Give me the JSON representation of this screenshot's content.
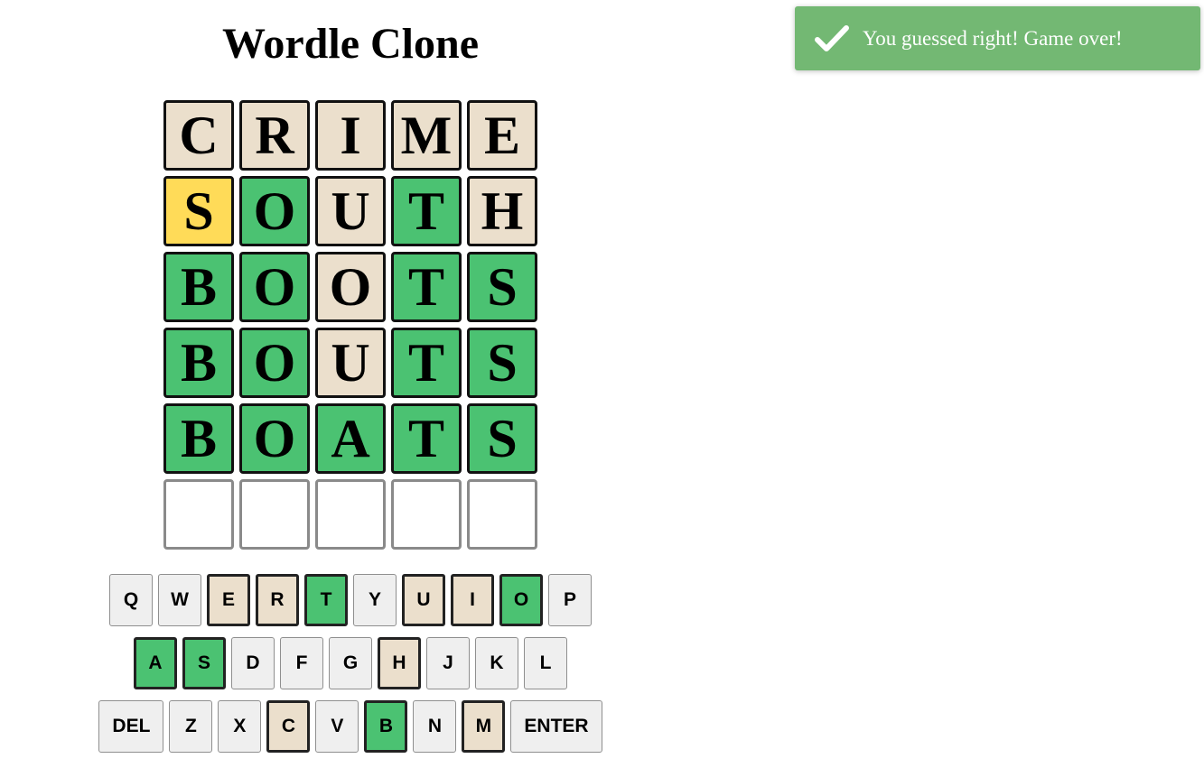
{
  "app": {
    "title": "Wordle Clone"
  },
  "colors": {
    "correct": "#4bc272",
    "present": "#ffdb58",
    "absent": "#ebdfcc",
    "empty": "#ffffff",
    "toast_bg": "#73b873"
  },
  "board": {
    "rows": [
      [
        {
          "letter": "C",
          "state": "absent"
        },
        {
          "letter": "R",
          "state": "absent"
        },
        {
          "letter": "I",
          "state": "absent"
        },
        {
          "letter": "M",
          "state": "absent"
        },
        {
          "letter": "E",
          "state": "absent"
        }
      ],
      [
        {
          "letter": "S",
          "state": "present"
        },
        {
          "letter": "O",
          "state": "correct"
        },
        {
          "letter": "U",
          "state": "absent"
        },
        {
          "letter": "T",
          "state": "correct"
        },
        {
          "letter": "H",
          "state": "absent"
        }
      ],
      [
        {
          "letter": "B",
          "state": "correct"
        },
        {
          "letter": "O",
          "state": "correct"
        },
        {
          "letter": "O",
          "state": "absent"
        },
        {
          "letter": "T",
          "state": "correct"
        },
        {
          "letter": "S",
          "state": "correct"
        }
      ],
      [
        {
          "letter": "B",
          "state": "correct"
        },
        {
          "letter": "O",
          "state": "correct"
        },
        {
          "letter": "U",
          "state": "absent"
        },
        {
          "letter": "T",
          "state": "correct"
        },
        {
          "letter": "S",
          "state": "correct"
        }
      ],
      [
        {
          "letter": "B",
          "state": "correct"
        },
        {
          "letter": "O",
          "state": "correct"
        },
        {
          "letter": "A",
          "state": "correct"
        },
        {
          "letter": "T",
          "state": "correct"
        },
        {
          "letter": "S",
          "state": "correct"
        }
      ],
      [
        {
          "letter": "",
          "state": "empty"
        },
        {
          "letter": "",
          "state": "empty"
        },
        {
          "letter": "",
          "state": "empty"
        },
        {
          "letter": "",
          "state": "empty"
        },
        {
          "letter": "",
          "state": "empty"
        }
      ]
    ]
  },
  "keyboard": {
    "rows": [
      [
        {
          "label": "Q",
          "state": "default"
        },
        {
          "label": "W",
          "state": "default"
        },
        {
          "label": "E",
          "state": "absent"
        },
        {
          "label": "R",
          "state": "absent"
        },
        {
          "label": "T",
          "state": "correct"
        },
        {
          "label": "Y",
          "state": "default"
        },
        {
          "label": "U",
          "state": "absent"
        },
        {
          "label": "I",
          "state": "absent"
        },
        {
          "label": "O",
          "state": "correct"
        },
        {
          "label": "P",
          "state": "default"
        }
      ],
      [
        {
          "label": "A",
          "state": "correct"
        },
        {
          "label": "S",
          "state": "correct"
        },
        {
          "label": "D",
          "state": "default"
        },
        {
          "label": "F",
          "state": "default"
        },
        {
          "label": "G",
          "state": "default"
        },
        {
          "label": "H",
          "state": "absent"
        },
        {
          "label": "J",
          "state": "default"
        },
        {
          "label": "K",
          "state": "default"
        },
        {
          "label": "L",
          "state": "default"
        }
      ],
      [
        {
          "label": "DEL",
          "state": "default",
          "wide": true
        },
        {
          "label": "Z",
          "state": "default"
        },
        {
          "label": "X",
          "state": "default"
        },
        {
          "label": "C",
          "state": "absent"
        },
        {
          "label": "V",
          "state": "default"
        },
        {
          "label": "B",
          "state": "correct"
        },
        {
          "label": "N",
          "state": "default"
        },
        {
          "label": "M",
          "state": "absent"
        },
        {
          "label": "ENTER",
          "state": "default",
          "wide": true
        }
      ]
    ]
  },
  "toast": {
    "icon": "checkmark-icon",
    "message": "You guessed right! Game over!"
  }
}
